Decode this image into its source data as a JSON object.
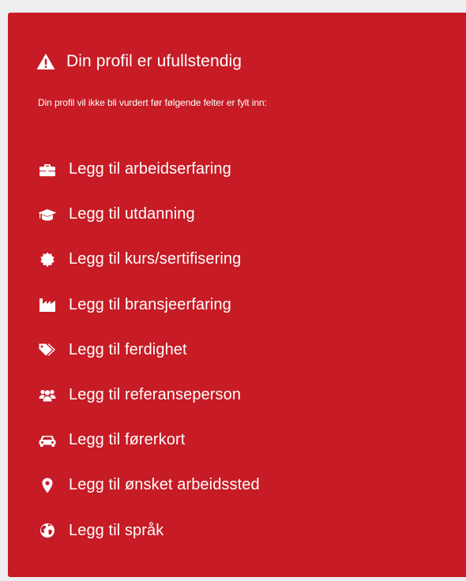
{
  "profile_warning": {
    "icon": "warning-icon",
    "title": "Din profil er ufullstendig",
    "subtitle": "Din profil vil ikke bli vurdert før følgende felter er fylt inn:",
    "background_color": "#c71b25",
    "text_color": "#ffffff"
  },
  "items": [
    {
      "icon": "briefcase-icon",
      "label": "Legg til arbeidserfaring"
    },
    {
      "icon": "graduation-cap-icon",
      "label": "Legg til utdanning"
    },
    {
      "icon": "certificate-icon",
      "label": "Legg til kurs/sertifisering"
    },
    {
      "icon": "industry-icon",
      "label": "Legg til bransjeerfaring"
    },
    {
      "icon": "tag-icon",
      "label": "Legg til ferdighet"
    },
    {
      "icon": "users-icon",
      "label": "Legg til referanseperson"
    },
    {
      "icon": "car-icon",
      "label": "Legg til førerkort"
    },
    {
      "icon": "map-marker-icon",
      "label": "Legg til ønsket arbeidssted"
    },
    {
      "icon": "globe-icon",
      "label": "Legg til språk"
    }
  ]
}
